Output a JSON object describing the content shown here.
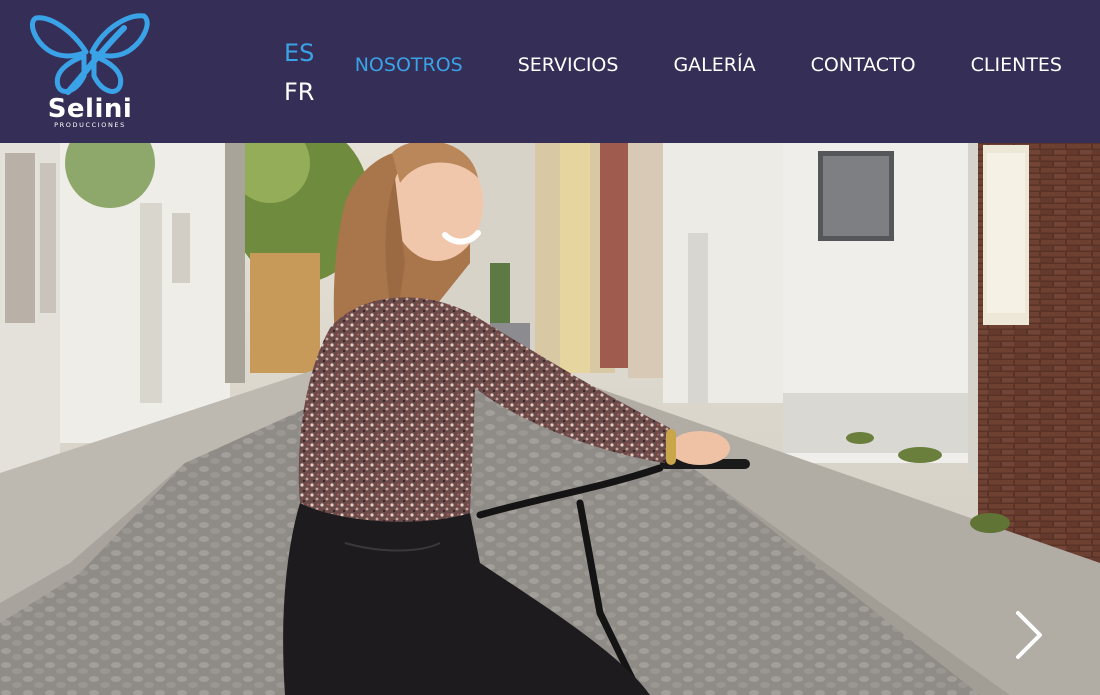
{
  "brand": {
    "name": "Selini",
    "tagline": "PRODUCCIONES",
    "logo_icon": "butterfly-icon",
    "colors": {
      "header_bg": "#352f57",
      "accent": "#3aa2e6",
      "text": "#ffffff"
    }
  },
  "languages": [
    {
      "code": "ES",
      "active": true
    },
    {
      "code": "FR",
      "active": false
    }
  ],
  "nav": {
    "items": [
      {
        "label": "NOSOTROS",
        "active": true
      },
      {
        "label": "SERVICIOS",
        "active": false
      },
      {
        "label": "GALERÍA",
        "active": false
      },
      {
        "label": "CONTACTO",
        "active": false
      },
      {
        "label": "CLIENTES",
        "active": false
      }
    ]
  },
  "hero": {
    "image_subject": "smiling-woman-on-bicycle-street-photo",
    "next_icon": "chevron-right-icon"
  }
}
